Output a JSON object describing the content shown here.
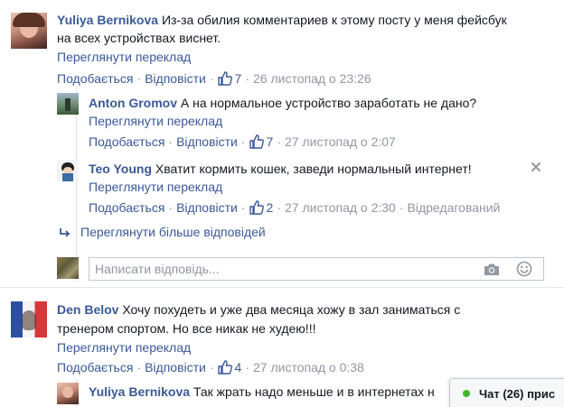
{
  "comments": [
    {
      "author": "Yuliya Bernikova",
      "text_line1": "Из-за обилия комментариев к этому посту у меня фейсбук",
      "text_line2": "на всех устройствах виснет.",
      "translate": "Переглянути переклад",
      "like_label": "Подобається",
      "reply_label": "Відповісти",
      "likes": "7",
      "date": "26 листопад о 23:26"
    },
    {
      "author": "Anton Gromov",
      "text": "А на нормальное устройство заработать не дано?",
      "translate": "Переглянути переклад",
      "like_label": "Подобається",
      "reply_label": "Відповісти",
      "likes": "7",
      "date": "27 листопад о 2:07"
    },
    {
      "author": "Teo Young",
      "text": "Хватит кормить кошек, заведи нормальный интернет!",
      "translate": "Переглянути переклад",
      "like_label": "Подобається",
      "reply_label": "Відповісти",
      "likes": "2",
      "date": "27 листопад о 2:30",
      "edited": "Відредагований"
    },
    {
      "author": "Den Belov",
      "text_line1": "Хочу похудеть и уже два месяца хожу в зал заниматься с",
      "text_line2": "тренером спортом. Но все никак не худею!!!",
      "translate": "Переглянути переклад",
      "like_label": "Подобається",
      "reply_label": "Відповісти",
      "likes": "4",
      "date": "27 листопад о 0:38"
    },
    {
      "author": "Yuliya Bernikova",
      "text": "Так жрать надо меньше и в интернетах н"
    }
  ],
  "more_replies": "Переглянути більше відповідей",
  "reply_input": {
    "placeholder": "Написати відповідь..."
  },
  "chat": {
    "label": "Чат (26) прис"
  },
  "icons": {
    "like": "thumbs-up-icon",
    "reply_arrow": "reply-arrow-icon",
    "camera": "camera-icon",
    "emoji": "smiley-icon",
    "close": "close-icon",
    "online": "online-dot-icon"
  },
  "colors": {
    "link": "#3b5998",
    "meta": "#9197a3",
    "text": "#141823",
    "online": "#42b72a"
  }
}
